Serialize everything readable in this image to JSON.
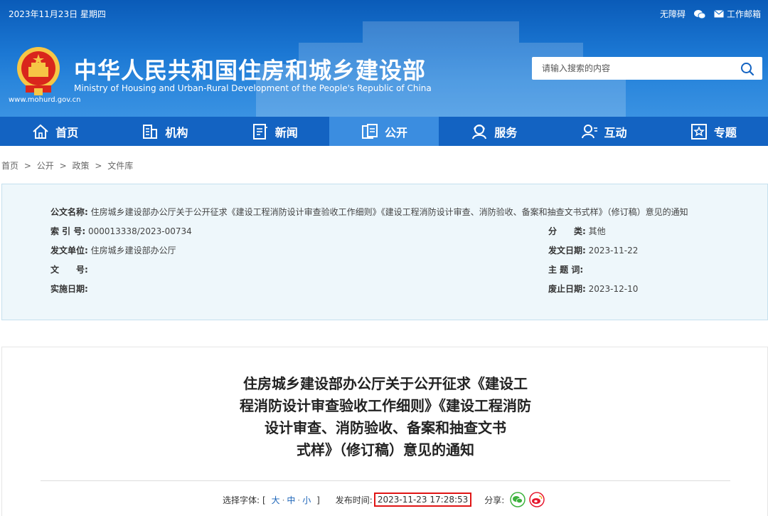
{
  "topbar": {
    "date": "2023年11月23日 星期四",
    "accessibility": "无障碍",
    "email": "工作邮箱"
  },
  "site": {
    "title_cn": "中华人民共和国住房和城乡建设部",
    "title_en": "Ministry of Housing and Urban-Rural Development of the People's Republic of China",
    "url": "www.mohurd.gov.cn"
  },
  "search": {
    "placeholder": "请输入搜索的内容"
  },
  "nav": [
    {
      "label": "首页",
      "icon": "home-icon"
    },
    {
      "label": "机构",
      "icon": "building-icon"
    },
    {
      "label": "新闻",
      "icon": "news-icon"
    },
    {
      "label": "公开",
      "icon": "open-icon"
    },
    {
      "label": "服务",
      "icon": "service-icon"
    },
    {
      "label": "互动",
      "icon": "interact-icon"
    },
    {
      "label": "专题",
      "icon": "topic-icon"
    }
  ],
  "nav_active": "公开",
  "breadcrumb": [
    "首页",
    ">",
    "公开",
    ">",
    "政策",
    ">",
    "文件库"
  ],
  "meta": {
    "doc_name_label": "公文名称:",
    "doc_name": "住房城乡建设部办公厅关于公开征求《建设工程消防设计审查验收工作细则》《建设工程消防设计审查、消防验收、备案和抽查文书式样》（修订稿）意见的通知",
    "index_label": "索 引 号:",
    "index": "000013338/2023-00734",
    "category_label": "分　　类:",
    "category": "其他",
    "issuer_label": "发文单位:",
    "issuer": "住房城乡建设部办公厅",
    "issue_date_label": "发文日期:",
    "issue_date": "2023-11-22",
    "docno_label": "文　　号:",
    "docno": "",
    "keywords_label": "主 题 词:",
    "keywords": "",
    "effective_label": "实施日期:",
    "effective": "",
    "expire_label": "废止日期:",
    "expire": "2023-12-10"
  },
  "article": {
    "title_lines": [
      "住房城乡建设部办公厅关于公开征求《建设工",
      "程消防设计审查验收工作细则》《建设工程消防",
      "设计审查、消防验收、备案和抽查文书",
      "式样》（修订稿）意见的通知"
    ],
    "font_label": "选择字体:",
    "font_open": "[",
    "font_large": "大",
    "font_medium": "中",
    "font_small": "小",
    "font_close": "]",
    "font_sep": "·",
    "pub_label": "发布时间:",
    "pub_time": "2023-11-23 17:28:53",
    "share_label": "分享:"
  },
  "colors": {
    "header_blue": "#1b77d3",
    "nav_blue": "#1363c2",
    "nav_active": "#3b8de0",
    "highlight_red": "#e01515",
    "wechat_green": "#3db23d",
    "weibo_red": "#e6162d"
  }
}
